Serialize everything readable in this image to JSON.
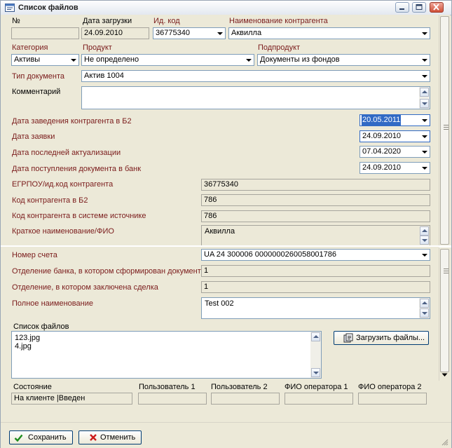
{
  "window": {
    "title": "Список файлов"
  },
  "header": {
    "no_label": "№",
    "no_value": "",
    "date_label": "Дата загрузки",
    "date_value": "24.09.2010",
    "idcode_label": "Ид. код",
    "idcode_value": "36775340",
    "contractor_label": "Наименование контрагента",
    "contractor_value": "Аквилла"
  },
  "row2": {
    "category_label": "Категория",
    "category_value": "Активы",
    "product_label": "Продукт",
    "product_value": "Не определено",
    "subproduct_label": "Подпродукт",
    "subproduct_value": "Документы из фондов"
  },
  "doc_type": {
    "label": "Тип документа",
    "value": "Актив 1004"
  },
  "comment": {
    "label": "Комментарий",
    "value": ""
  },
  "dates": [
    {
      "label": "Дата заведения контрагента в Б2",
      "value": "20.05.2011"
    },
    {
      "label": "Дата заявки",
      "value": "24.09.2010"
    },
    {
      "label": "Дата последней актуализации",
      "value": "07.04.2020"
    },
    {
      "label": "Дата поступления документа в банк",
      "value": "24.09.2010"
    }
  ],
  "codes": [
    {
      "label": "ЕГРПОУ/ид.код контрагента",
      "value": "36775340"
    },
    {
      "label": "Код контрагента в Б2",
      "value": "786"
    },
    {
      "label": "Код контрагента в системе источнике",
      "value": "786"
    }
  ],
  "short_name": {
    "label": "Краткое наименование/ФИО",
    "value": "Аквилла"
  },
  "account": {
    "label": "Номер счета",
    "value": "UA 24 300006 0000000260058001786"
  },
  "branch_created": {
    "label": "Отделение банка, в котором сформирован документ",
    "value": "1"
  },
  "branch_deal": {
    "label": "Отделение, в котором заключена сделка",
    "value": "1"
  },
  "full_name": {
    "label": "Полное наименование",
    "value": "Test 002"
  },
  "files": {
    "label": "Список файлов",
    "items": [
      "123.jpg",
      "4.jpg"
    ],
    "upload_label": "Загрузить файлы..."
  },
  "status": {
    "state_label": "Состояние",
    "state_value": "На клиенте |Введен",
    "user1_label": "Пользователь 1",
    "user1_value": "",
    "user2_label": "Пользователь 2",
    "user2_value": "",
    "op1_label": "ФИО оператора 1",
    "op1_value": "",
    "op2_label": "ФИО оператора 2",
    "op2_value": ""
  },
  "actions": {
    "save_label": "Сохранить",
    "cancel_label": "Отменить"
  },
  "colors": {
    "label_accent": "#7a1b1b",
    "selection": "#316ac5",
    "field_border": "#7f9db9"
  }
}
